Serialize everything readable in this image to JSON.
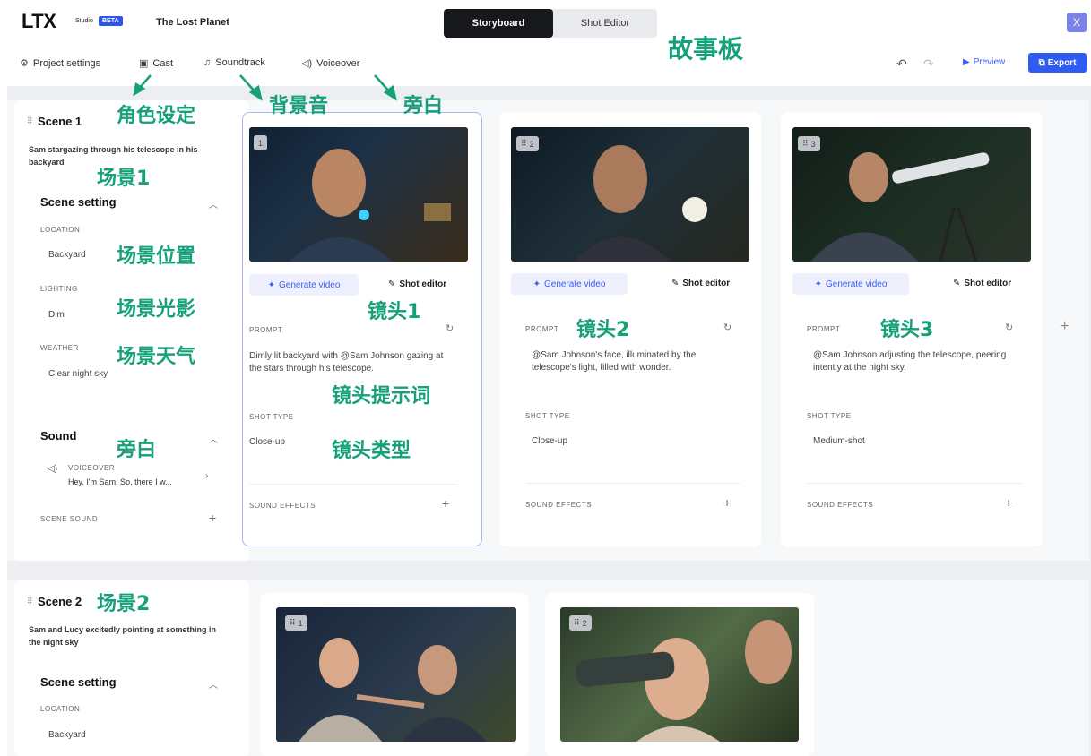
{
  "app": {
    "logo": "LTX",
    "studio": "Studio",
    "beta": "BETA",
    "project_title": "The Lost Planet",
    "close": "X"
  },
  "modes": {
    "storyboard": "Storyboard",
    "shot_editor": "Shot Editor",
    "active": "storyboard"
  },
  "toolbar": {
    "project_settings": "Project settings",
    "cast": "Cast",
    "soundtrack": "Soundtrack",
    "voiceover": "Voiceover",
    "preview": "Preview",
    "export": "Export"
  },
  "annotations": {
    "storyboard": "故事板",
    "cast": "角色设定",
    "soundtrack": "背景音",
    "voiceover": "旁白",
    "scene1": "场景1",
    "location": "场景位置",
    "lighting": "场景光影",
    "weather": "场景天气",
    "sound": "旁白",
    "shot1": "镜头1",
    "shot2": "镜头2",
    "shot3": "镜头3",
    "prompt": "镜头提示词",
    "shot_type": "镜头类型",
    "scene2": "场景2"
  },
  "scene1": {
    "title": "Scene 1",
    "description": "Sam stargazing through his telescope in his backyard",
    "setting_heading": "Scene setting",
    "location_label": "LOCATION",
    "location_value": "Backyard",
    "lighting_label": "LIGHTING",
    "lighting_value": "Dim",
    "weather_label": "WEATHER",
    "weather_value": "Clear night sky",
    "sound_heading": "Sound",
    "voiceover_label": "VOICEOVER",
    "voiceover_text": "Hey, I'm Sam. So, there I w...",
    "scene_sound_label": "SCENE SOUND",
    "shots": [
      {
        "number": "1",
        "generate": "Generate video",
        "shot_editor": "Shot editor",
        "prompt_label": "PROMPT",
        "prompt": "Dimly lit backyard with @Sam Johnson gazing at the stars through his telescope.",
        "shot_type_label": "SHOT TYPE",
        "shot_type": "Close-up",
        "sound_effects_label": "SOUND EFFECTS"
      },
      {
        "number": "2",
        "generate": "Generate video",
        "shot_editor": "Shot editor",
        "prompt_label": "PROMPT",
        "prompt": "@Sam Johnson's face, illuminated by the telescope's light, filled with wonder.",
        "shot_type_label": "SHOT TYPE",
        "shot_type": "Close-up",
        "sound_effects_label": "SOUND EFFECTS"
      },
      {
        "number": "3",
        "generate": "Generate video",
        "shot_editor": "Shot editor",
        "prompt_label": "PROMPT",
        "prompt": "@Sam Johnson adjusting the telescope, peering intently at the night sky.",
        "shot_type_label": "SHOT TYPE",
        "shot_type": "Medium-shot",
        "sound_effects_label": "SOUND EFFECTS"
      }
    ]
  },
  "scene2": {
    "title": "Scene 2",
    "description": "Sam and Lucy excitedly pointing at something in the night sky",
    "setting_heading": "Scene setting",
    "location_label": "LOCATION",
    "location_value": "Backyard",
    "shots": [
      {
        "number": "1"
      },
      {
        "number": "2"
      }
    ]
  },
  "icons": {
    "project_settings": "gear-icon",
    "cast": "person-card-icon",
    "soundtrack": "music-note-icon",
    "voiceover": "speaker-icon",
    "undo": "undo-icon",
    "redo": "redo-icon",
    "preview": "play-icon",
    "export": "export-icon",
    "generate": "sparkle-icon",
    "shot_editor": "edit-icon",
    "refresh": "refresh-icon",
    "add": "plus-icon",
    "collapse": "chevron-up-icon"
  },
  "colors": {
    "accent": "#2f5cf0",
    "annotation": "#15a07a",
    "active_tab": "#17181c",
    "selected_border": "#a9b8f4"
  }
}
